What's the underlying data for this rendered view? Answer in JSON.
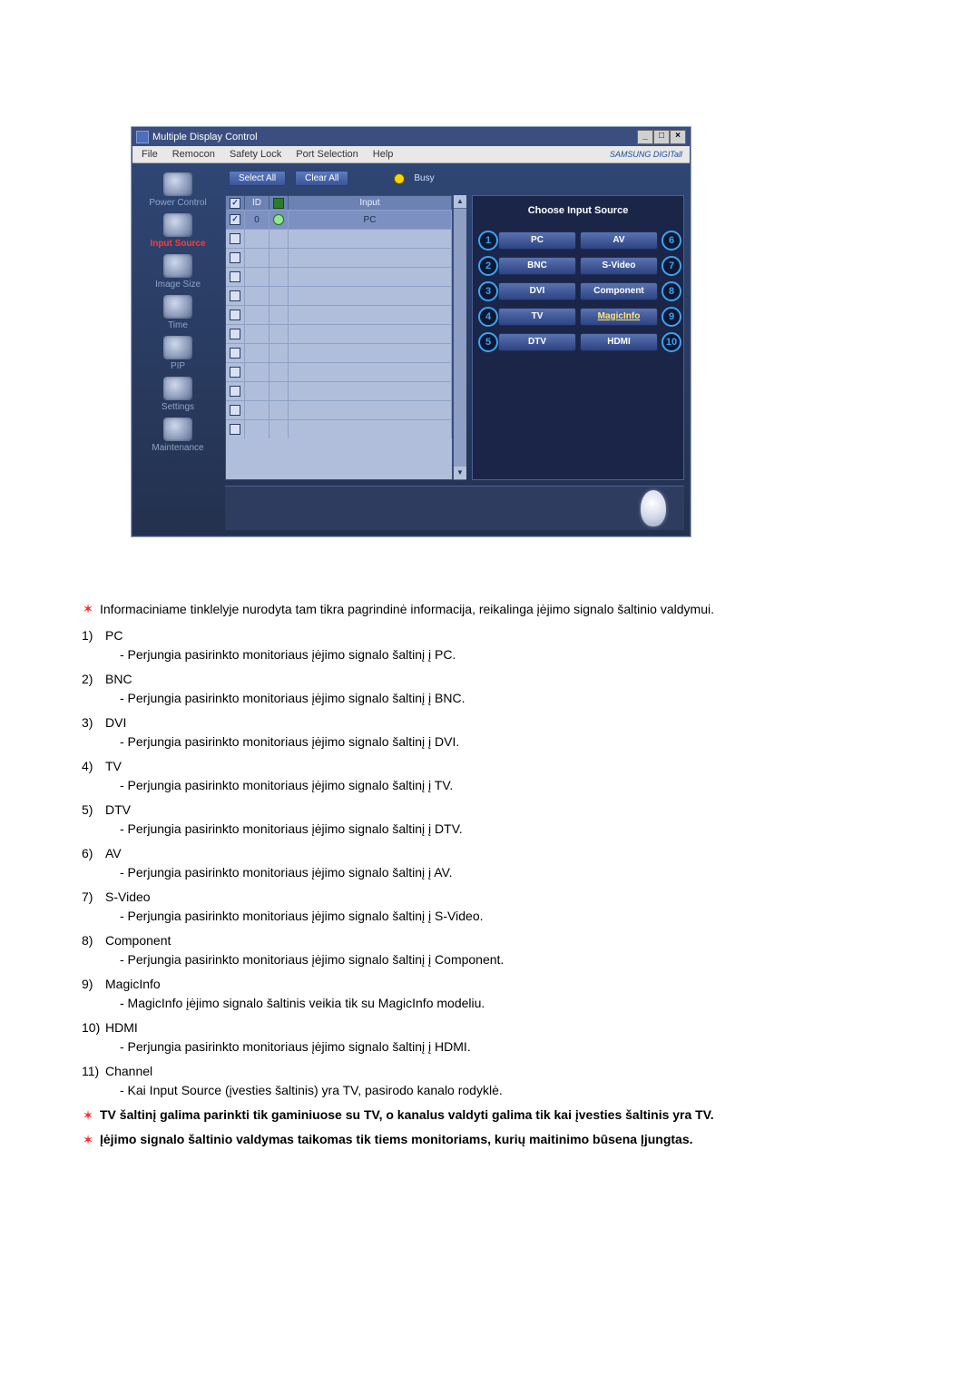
{
  "app": {
    "title": "Multiple Display Control",
    "menus": [
      "File",
      "Remocon",
      "Safety Lock",
      "Port Selection",
      "Help"
    ],
    "brand": "SAMSUNG DIGITall"
  },
  "sidebar": {
    "items": [
      {
        "label": "Power Control"
      },
      {
        "label": "Input Source"
      },
      {
        "label": "Image Size"
      },
      {
        "label": "Time"
      },
      {
        "label": "PIP"
      },
      {
        "label": "Settings"
      },
      {
        "label": "Maintenance"
      }
    ]
  },
  "buttons": {
    "select_all": "Select All",
    "clear_all": "Clear All",
    "busy": "Busy"
  },
  "grid": {
    "headers": {
      "id": "ID",
      "input": "Input"
    },
    "first_row": {
      "id": "0",
      "input": "PC"
    }
  },
  "panel": {
    "title": "Choose Input Source",
    "left": [
      {
        "n": "1",
        "label": "PC"
      },
      {
        "n": "2",
        "label": "BNC"
      },
      {
        "n": "3",
        "label": "DVI"
      },
      {
        "n": "4",
        "label": "TV"
      },
      {
        "n": "5",
        "label": "DTV"
      }
    ],
    "right": [
      {
        "n": "6",
        "label": "AV"
      },
      {
        "n": "7",
        "label": "S-Video"
      },
      {
        "n": "8",
        "label": "Component"
      },
      {
        "n": "9",
        "label": "MagicInfo"
      },
      {
        "n": "10",
        "label": "HDMI"
      }
    ]
  },
  "doc": {
    "intro": "Informaciniame tinklelyje nurodyta tam tikra pagrindinė informacija, reikalinga įėjimo signalo šaltinio valdymui.",
    "items": [
      {
        "term": "PC",
        "desc": "- Perjungia pasirinkto monitoriaus įėjimo signalo šaltinį į PC."
      },
      {
        "term": "BNC",
        "desc": "- Perjungia pasirinkto monitoriaus įėjimo signalo šaltinį į BNC."
      },
      {
        "term": "DVI",
        "desc": "- Perjungia pasirinkto monitoriaus įėjimo signalo šaltinį į DVI."
      },
      {
        "term": "TV",
        "desc": "- Perjungia pasirinkto monitoriaus įėjimo signalo šaltinį į TV."
      },
      {
        "term": "DTV",
        "desc": "- Perjungia pasirinkto monitoriaus įėjimo signalo šaltinį į DTV."
      },
      {
        "term": "AV",
        "desc": "- Perjungia pasirinkto monitoriaus įėjimo signalo šaltinį į AV."
      },
      {
        "term": "S-Video",
        "desc": "- Perjungia pasirinkto monitoriaus įėjimo signalo šaltinį į S-Video."
      },
      {
        "term": "Component",
        "desc": "- Perjungia pasirinkto monitoriaus įėjimo signalo šaltinį į Component."
      },
      {
        "term": "MagicInfo",
        "desc": "- MagicInfo įėjimo signalo šaltinis veikia tik su MagicInfo modeliu."
      },
      {
        "term": "HDMI",
        "desc": "- Perjungia pasirinkto monitoriaus įėjimo signalo šaltinį į HDMI."
      },
      {
        "term": "Channel",
        "desc": "- Kai Input Source (įvesties šaltinis) yra TV, pasirodo kanalo rodyklė."
      }
    ],
    "note1": "TV šaltinį galima parinkti tik gaminiuose su TV, o kanalus valdyti galima tik kai įvesties šaltinis yra TV.",
    "note2": "Įėjimo signalo šaltinio valdymas taikomas tik tiems monitoriams, kurių maitinimo būsena Įjungtas."
  }
}
